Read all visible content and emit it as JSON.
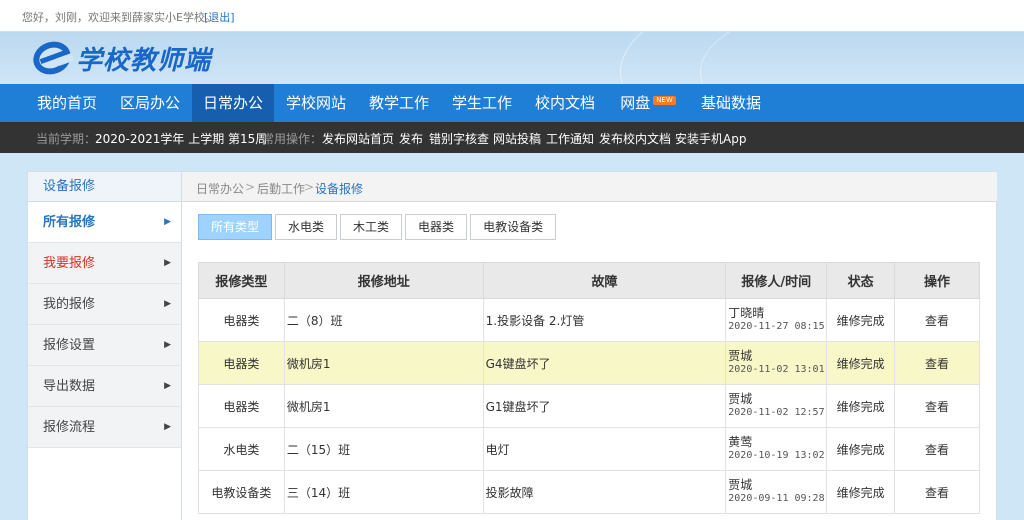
{
  "topbar": {
    "greeting": "您好，刘刚，欢迎来到薛家实小E学校。",
    "logout": "[退出]"
  },
  "logo": {
    "letter": "e",
    "text": "学校教师端"
  },
  "nav": {
    "items": [
      "我的首页",
      "区局办公",
      "日常办公",
      "学校网站",
      "教学工作",
      "学生工作",
      "校内文档",
      "网盘",
      "基础数据"
    ],
    "active_index": 2,
    "new_badge": "NEW"
  },
  "subbar": {
    "term_label": "当前学期：",
    "term_value": "2020-2021学年 上学期 第15周",
    "ops_label": "常用操作：",
    "ops": [
      "发布网站首页",
      "发布",
      "错别字核查",
      "网站投稿",
      "工作通知",
      "发布校内文档",
      "安装手机App"
    ]
  },
  "sidebar": {
    "title": "设备报修",
    "items": [
      "所有报修",
      "我要报修",
      "我的报修",
      "报修设置",
      "导出数据",
      "报修流程"
    ],
    "arrow": "▶"
  },
  "breadcrumb": [
    "日常办公",
    "后勤工作",
    "设备报修"
  ],
  "breadcrumb_sep": ">",
  "tabs": [
    "所有类型",
    "水电类",
    "木工类",
    "电器类",
    "电教设备类"
  ],
  "table": {
    "headers": [
      "报修类型",
      "报修地址",
      "故障",
      "报修人/时间",
      "状态",
      "操作"
    ],
    "rows": [
      {
        "type": "电器类",
        "address": "二（8）班",
        "fault": "1.投影设备 2.灯管",
        "person": "丁晓晴",
        "time": "2020-11-27 08:15",
        "status": "维修完成",
        "action": "查看"
      },
      {
        "type": "电器类",
        "address": "微机房1",
        "fault": "G4键盘坏了",
        "person": "贾城",
        "time": "2020-11-02 13:01",
        "status": "维修完成",
        "action": "查看"
      },
      {
        "type": "电器类",
        "address": "微机房1",
        "fault": "G1键盘坏了",
        "person": "贾城",
        "time": "2020-11-02 12:57",
        "status": "维修完成",
        "action": "查看"
      },
      {
        "type": "水电类",
        "address": "二（15）班",
        "fault": "电灯",
        "person": "黄莺",
        "time": "2020-10-19 13:02",
        "status": "维修完成",
        "action": "查看"
      },
      {
        "type": "电教设备类",
        "address": "三（14）班",
        "fault": "投影故障",
        "person": "贾城",
        "time": "2020-09-11 09:28",
        "status": "维修完成",
        "action": "查看"
      }
    ]
  },
  "colors": {
    "nav": "#1f7fd6",
    "nav_active": "#155fae",
    "subbar": "#333333",
    "accent": "#2a74c0",
    "highlight_row": "#f8f7c8",
    "tab_active": "#9fd3ff"
  }
}
